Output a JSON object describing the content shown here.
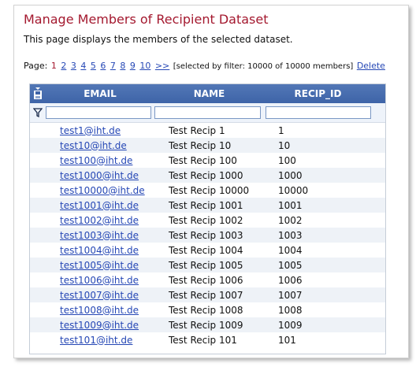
{
  "page": {
    "title": "Manage Members of Recipient Dataset",
    "subtitle": "This page displays the members of the selected dataset."
  },
  "pager": {
    "label": "Page:",
    "current": "1",
    "pages": [
      "2",
      "3",
      "4",
      "5",
      "6",
      "7",
      "8",
      "9",
      "10"
    ],
    "next": ">>",
    "filter_text": "[selected by filter: 10000 of 10000 members]",
    "delete_label": "Delete"
  },
  "grid": {
    "icons": {
      "export": "save-export-icon",
      "filter": "funnel-icon"
    },
    "columns": [
      "EMAIL",
      "NAME",
      "RECIP_ID"
    ],
    "filter_values": [
      "",
      "",
      ""
    ],
    "rows": [
      [
        "test1@iht.de",
        "Test Recip 1",
        "1"
      ],
      [
        "test10@iht.de",
        "Test Recip 10",
        "10"
      ],
      [
        "test100@iht.de",
        "Test Recip 100",
        "100"
      ],
      [
        "test1000@iht.de",
        "Test Recip 1000",
        "1000"
      ],
      [
        "test10000@iht.de",
        "Test Recip 10000",
        "10000"
      ],
      [
        "test1001@iht.de",
        "Test Recip 1001",
        "1001"
      ],
      [
        "test1002@iht.de",
        "Test Recip 1002",
        "1002"
      ],
      [
        "test1003@iht.de",
        "Test Recip 1003",
        "1003"
      ],
      [
        "test1004@iht.de",
        "Test Recip 1004",
        "1004"
      ],
      [
        "test1005@iht.de",
        "Test Recip 1005",
        "1005"
      ],
      [
        "test1006@iht.de",
        "Test Recip 1006",
        "1006"
      ],
      [
        "test1007@iht.de",
        "Test Recip 1007",
        "1007"
      ],
      [
        "test1008@iht.de",
        "Test Recip 1008",
        "1008"
      ],
      [
        "test1009@iht.de",
        "Test Recip 1009",
        "1009"
      ],
      [
        "test101@iht.de",
        "Test Recip 101",
        "101"
      ]
    ]
  },
  "colors": {
    "title": "#a4192f",
    "link": "#2547b5",
    "header": "#4a6fb0"
  }
}
